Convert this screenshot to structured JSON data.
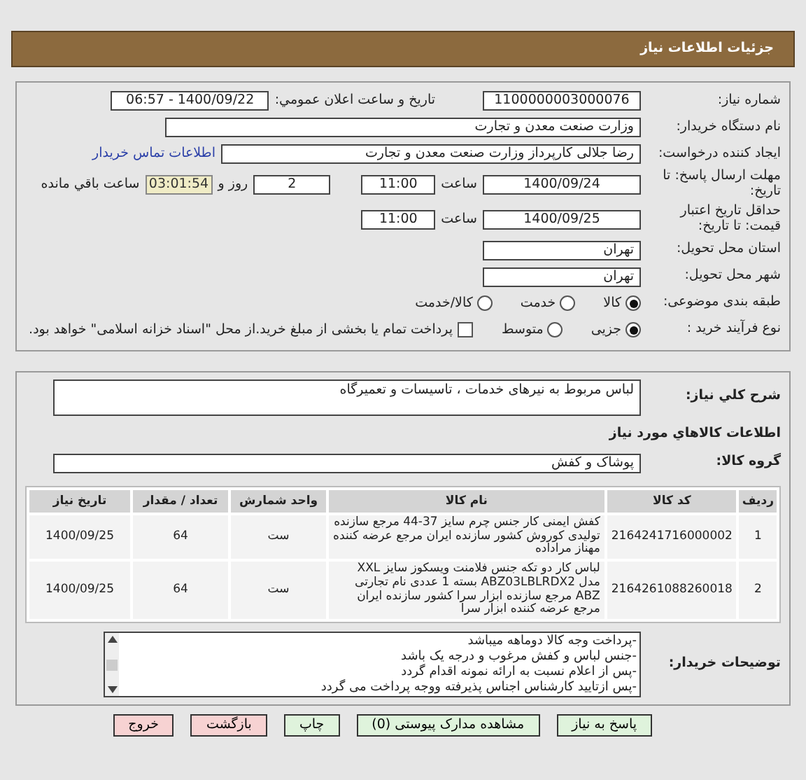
{
  "header": {
    "title": "جزئیات اطلاعات نیاز"
  },
  "need_number": {
    "label": "شماره نیاز:",
    "value": "1100000003000076"
  },
  "announce": {
    "label": "تاریخ و ساعت اعلان عمومي:",
    "value": "1400/09/22 - 06:57"
  },
  "buyer_org": {
    "label": "نام دستگاه خریدار:",
    "value": "وزارت صنعت معدن و تجارت"
  },
  "requester": {
    "label": "ایجاد کننده درخواست:",
    "value": "رضا جلالی کارپرداز وزارت صنعت معدن و تجارت",
    "link": "اطلاعات تماس خریدار"
  },
  "deadline": {
    "label": "مهلت ارسال پاسخ: تا تاریخ:",
    "date": "1400/09/24",
    "time_label": "ساعت",
    "time": "11:00",
    "days": "2",
    "days_label": "روز و",
    "remaining": "03:01:54",
    "remaining_label": "ساعت باقي مانده"
  },
  "validity": {
    "label": "حداقل تاریخ اعتبار قیمت: تا تاریخ:",
    "date": "1400/09/25",
    "time_label": "ساعت",
    "time": "11:00"
  },
  "province": {
    "label": "استان محل تحویل:",
    "value": "تهران"
  },
  "city": {
    "label": "شهر محل تحویل:",
    "value": "تهران"
  },
  "category": {
    "label": "طبقه بندی موضوعی:",
    "options": [
      {
        "label": "کالا",
        "selected": true
      },
      {
        "label": "خدمت",
        "selected": false
      },
      {
        "label": "کالا/خدمت",
        "selected": false
      }
    ]
  },
  "process": {
    "label": "نوع فرآیند خرید :",
    "options": [
      {
        "label": "جزیی",
        "selected": true
      },
      {
        "label": "متوسط",
        "selected": false
      }
    ],
    "payment": {
      "checked": false,
      "text": "پرداخت تمام یا بخشی از مبلغ خرید.از محل \"اسناد خزانه اسلامی\" خواهد بود."
    }
  },
  "description": {
    "label": "شرح کلي نیاز:",
    "value": "لباس مربوط به نیرهای خدمات ، تاسیسات و تعمیرگاه"
  },
  "goods_title": "اطلاعات کالاهاي مورد نیاز",
  "goods_group": {
    "label": "گروه کالا:",
    "value": "پوشاک و کفش"
  },
  "table": {
    "columns": [
      "ردیف",
      "کد کالا",
      "نام کالا",
      "واحد شمارش",
      "تعداد / مقدار",
      "تاریخ نیاز"
    ],
    "rows": [
      [
        "1",
        "2164241716000002",
        "کفش ایمنی کار جنس چرم سایز 37-44 مرجع سازنده تولیدی کوروش کشور سازنده ایران مرجع عرضه کننده مهناز مراداده",
        "ست",
        "64",
        "1400/09/25"
      ],
      [
        "2",
        "2164261088260018",
        "لباس کار دو تکه جنس فلامنت ویسکوز سایز XXL مدل ABZ03LBLRDX2 بسته 1 عددی نام تجارتی ABZ مرجع سازنده ابزار سرا کشور سازنده ایران مرجع عرضه کننده ابزار سرا",
        "ست",
        "64",
        "1400/09/25"
      ]
    ]
  },
  "buyer_notes": {
    "label": "توضیحات خریدار:",
    "lines": [
      "-پرداخت وجه کالا دوماهه میباشد",
      "-جنس لباس و کفش مرغوب و درجه یک باشد",
      "-پس از اعلام نسبت به ارائه نمونه اقدام گردد",
      "-پس ازتایید کارشناس اجناس پذیرفته ووجه پرداخت می گردد"
    ]
  },
  "buttons": [
    {
      "label": "پاسخ به نیاز",
      "kind": "green"
    },
    {
      "label": "مشاهده مدارک پیوستی (0)",
      "kind": "green"
    },
    {
      "label": "چاپ",
      "kind": "green"
    },
    {
      "label": "بازگشت",
      "kind": "red"
    },
    {
      "label": "خروج",
      "kind": "red"
    }
  ]
}
